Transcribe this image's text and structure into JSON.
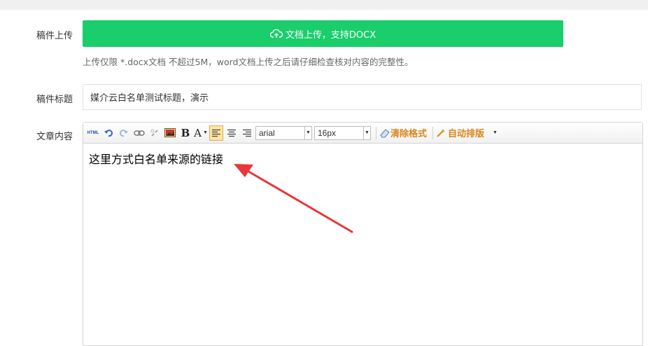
{
  "form": {
    "upload_label": "稿件上传",
    "upload_button": "文档上传，支持DOCX",
    "upload_hint": "上传仅限 *.docx文档 不超过5M，word文档上传之后请仔细检查核对内容的完整性。",
    "title_label": "稿件标题",
    "title_value": "媒介云白名单测试标题，演示",
    "content_label": "文章内容"
  },
  "editor": {
    "toolbar": {
      "html_label": "HTML",
      "bold_label": "B",
      "fontcolor_label": "A",
      "font_family": "arial",
      "font_size": "16px",
      "clear_format_label": "清除格式",
      "auto_layout_label": "自动排版"
    },
    "content_text": "这里方式白名单来源的链接"
  },
  "colors": {
    "accent_green": "#19ce6b",
    "annotation_red": "#e8363a",
    "toolbar_orange": "#d8861d"
  }
}
